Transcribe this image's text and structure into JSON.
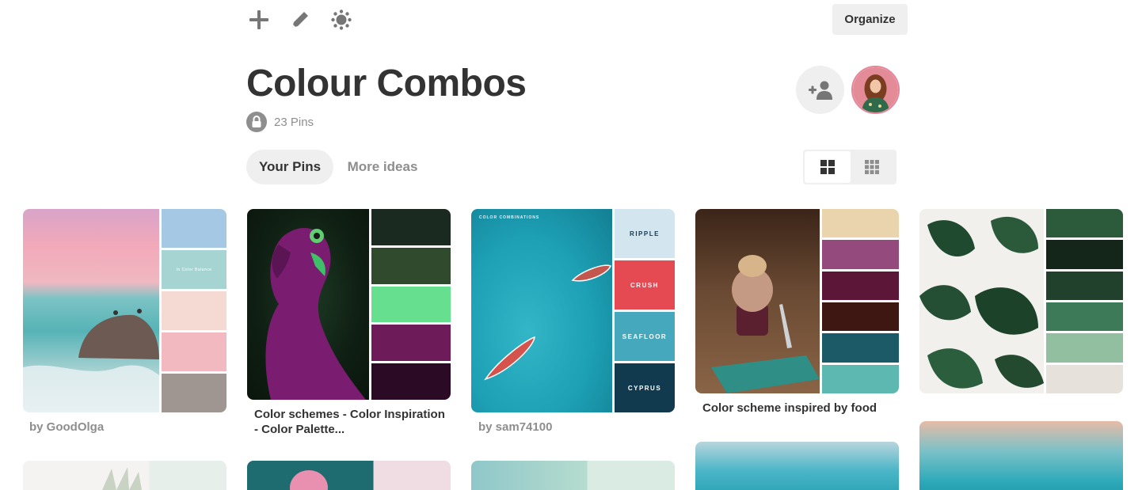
{
  "toolbar": {
    "icons": [
      "plus-icon",
      "pencil-icon",
      "sparkle-icon"
    ],
    "organize_label": "Organize"
  },
  "board": {
    "title": "Colour Combos",
    "pin_count": "23 Pins",
    "privacy_icon": "lock-icon"
  },
  "tabs": [
    {
      "label": "Your Pins",
      "active": true
    },
    {
      "label": "More ideas",
      "active": false
    }
  ],
  "view_toggle": {
    "options": [
      "grid-large-icon",
      "grid-small-icon"
    ],
    "selected": "grid-large-icon"
  },
  "pins": [
    {
      "caption": "by GoodOlga",
      "photo_text": "In Color Balance",
      "swatches": [
        "#a5c8e4",
        "#a6d4d3",
        "#f5dad4",
        "#f3b9c0",
        "#a09691"
      ]
    },
    {
      "caption": "Color schemes - Color Inspiration - Color Palette...",
      "photo_text": "",
      "swatches": [
        "#1b2a20",
        "#304a2e",
        "#66e08f",
        "#6d1c59",
        "#2a0a24"
      ]
    },
    {
      "caption": "by sam74100",
      "photo_text": "COLOR COMBINATIONS",
      "swatch_labels": [
        "RIPPLE",
        "CRUSH",
        "SEAFLOOR",
        "CYPRUS"
      ],
      "swatches": [
        "#d3e6ef",
        "#e54a53",
        "#45a8bd",
        "#113a4f"
      ]
    },
    {
      "caption": "Color scheme inspired by food",
      "photo_text": "",
      "swatches": [
        "#e9d4ad",
        "#954a7d",
        "#5c1637",
        "#3f1712",
        "#1c5a68",
        "#5cb8b1"
      ]
    },
    {
      "caption": "",
      "photo_text": "",
      "swatches": [
        "#2c5b3c",
        "#14261a",
        "#21412d",
        "#3c7a58",
        "#92bf9f",
        "#e7e1dc"
      ]
    }
  ],
  "colors": {
    "text_primary": "#333333",
    "text_muted": "#8e8e8e",
    "button_bg": "#efefef"
  }
}
